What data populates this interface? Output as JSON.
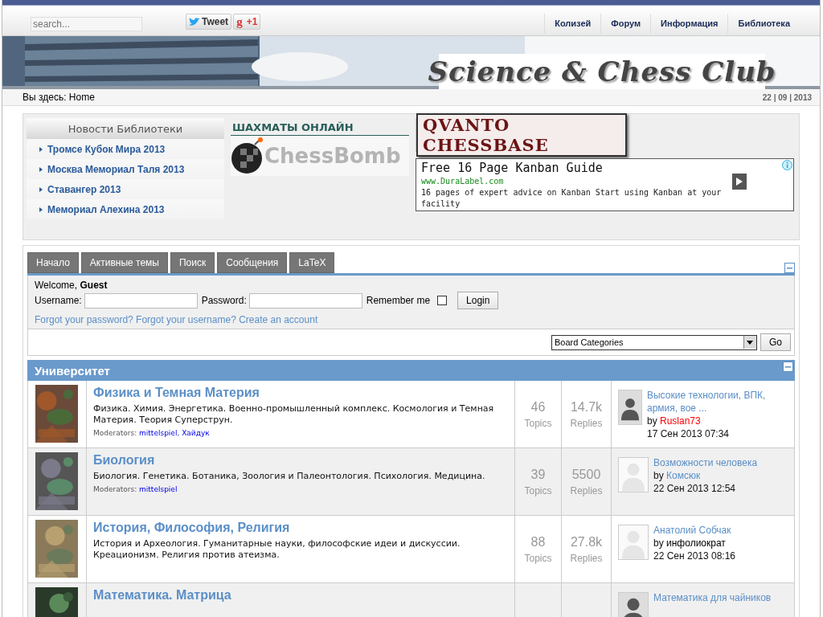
{
  "top_bar": {
    "search": {
      "placeholder": "search..."
    },
    "share": [
      {
        "kind": "tweet",
        "label": "Tweet"
      },
      {
        "kind": "plusone",
        "icon": "g",
        "label": "+1"
      }
    ],
    "nav": [
      "Колизей",
      "Форум",
      "Информация",
      "Библиотека"
    ]
  },
  "banner": {
    "title": "Science & Chess Club"
  },
  "breadcrumb": {
    "label": "Вы здесь:",
    "current": "Home",
    "date": "22 | 09 | 2013"
  },
  "library_news": {
    "title": "Новости Библиотеки",
    "items": [
      "Тромсе Кубок Мира 2013",
      "Москва Мемориал Таля 2013",
      "Ставангер 2013",
      "Мемориал Алехина 2013"
    ]
  },
  "chess_online": {
    "title": "ШАХМАТЫ ОНЛАЙН",
    "logo": "ChessBomb"
  },
  "promo_banner": {
    "label": "QVANTO CHESSBASE"
  },
  "ad": {
    "headline": "Free 16 Page Kanban Guide",
    "url": "www.DuraLabel.com",
    "text": "16 pages of expert advice on Kanban Start using Kanban at your facility"
  },
  "forum_tabs": [
    "Начало",
    "Активные темы",
    "Поиск",
    "Сообщения",
    "LaTeX"
  ],
  "login": {
    "welcome": "Welcome, **Guest**",
    "username_label": "Username:",
    "password_label": "Password:",
    "remember_label": "Remember me",
    "remember_checked": false,
    "button": "Login",
    "links": [
      "Forgot your password?",
      "Forgot your username?",
      "Create an account"
    ]
  },
  "board_select": {
    "value": "Board Categories",
    "button": "Go"
  },
  "category": {
    "title": "Университет",
    "boards": [
      {
        "title": "Физика и Темная Материя",
        "description": "Физика. Химия. Энергетика. Военно-промышленный комплекс. Космология и Темная Материя. Теория Суперструн.",
        "moderators_label": "Moderators:",
        "moderators": [
          "mittelspiel",
          "Хайдук"
        ],
        "separator": ",",
        "topics": "46",
        "topics_label": "Topics",
        "replies": "14.7k",
        "replies_label": "Replies",
        "last_post": {
          "title": "Высокие технологии, ВПК, армия, вое ...",
          "by": "by",
          "author": "Ruslan73",
          "color": "#ff0000",
          "date": "17 Сен 2013 07:34"
        }
      },
      {
        "title": "Биология",
        "description": "Биология. Генетика. Ботаника, Зоология и Палеонтология. Психология. Медицина.",
        "moderators_label": "Moderators:",
        "moderators": [
          "mittelspiel"
        ],
        "topics": "39",
        "topics_label": "Topics",
        "replies": "5500",
        "replies_label": "Replies",
        "last_post": {
          "title": "Возможности человека",
          "by": "by",
          "author": "Комсюк",
          "color": "#5a8fcc",
          "date": "22 Сен 2013 12:54",
          "kind": "default"
        }
      },
      {
        "title": "История, Философия, Религия",
        "description": "История и Археология. Гуманитарные науки, философские идеи и дискуссии. Креационизм. Религия против атеизма.",
        "topics": "88",
        "topics_label": "Topics",
        "replies": "27.8k",
        "replies_label": "Replies",
        "last_post": {
          "title": "Анатолий Собчак",
          "by": "by",
          "author": "инфолиократ",
          "color": "#000000",
          "date": "22 Сен 2013 08:16",
          "kind": "default"
        }
      },
      {
        "title": "Математика. Матрица",
        "last_post": {
          "title": "Математика для чайников"
        }
      }
    ]
  }
}
